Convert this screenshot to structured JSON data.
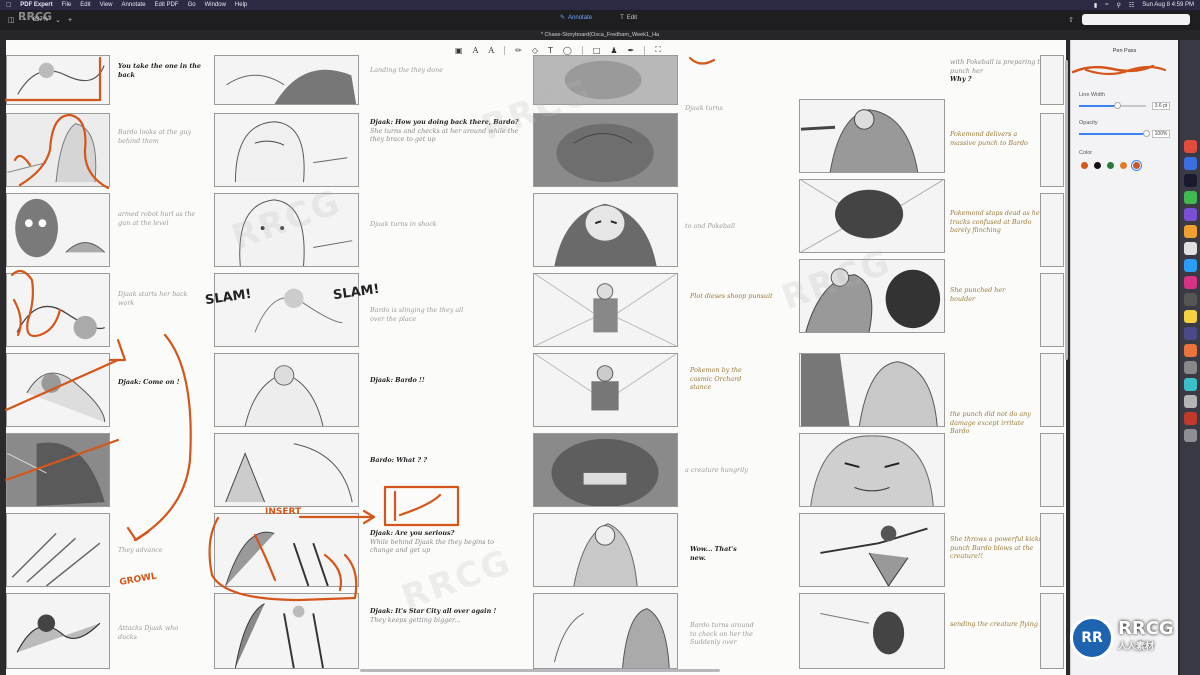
{
  "menubar": {
    "app_name": "PDF Expert",
    "menus": [
      "File",
      "Edit",
      "View",
      "Annotate",
      "Edit PDF",
      "Go",
      "Window",
      "Help"
    ],
    "clock": "Sun Aug 8  4:59 PM"
  },
  "toolbar": {
    "zoom": "837%",
    "modes": [
      {
        "label": "Annotate",
        "active": true
      },
      {
        "label": "Edit",
        "active": false
      }
    ],
    "search_placeholder": ""
  },
  "document": {
    "tab_title": "* Chase-Storyboard(Osca_Fredham_Week1_Ha"
  },
  "watermark": {
    "logo": "RRCG",
    "badge_circle": "RR",
    "badge_title": "RRCG",
    "badge_sub": "人人素材"
  },
  "panel": {
    "title": "Pen Pass",
    "line_width_label": "Line Width",
    "line_width_value": "3.6 pt",
    "line_width_fraction": 0.58,
    "opacity_label": "Opacity",
    "opacity_value": "100%",
    "opacity_fraction": 1.0,
    "color_label": "Color",
    "swatches": [
      "#d4561a",
      "#111111",
      "#2a7a3a",
      "#e07b26",
      "#c9562a"
    ],
    "selected_swatch": 4,
    "pen_color": "#d4561a"
  },
  "sketch_labels": {
    "slam_left": "SLAM!",
    "slam_right": "SLAM!",
    "insert": "INSERT",
    "growl": "GROWL"
  },
  "storyboard": {
    "column1_captions": [
      {
        "text": "You take the one in the back",
        "style": "bold"
      },
      {
        "text": "Bardo looks at the guy behind them",
        "style": "light"
      },
      {
        "text": "armed robot hurl as the gun at the level",
        "style": "light"
      },
      {
        "text": "Djaak starts her back work",
        "style": "light"
      },
      {
        "text": "Djaak: Come on !",
        "style": "bold"
      },
      {
        "text": "",
        "style": "light"
      },
      {
        "text": "They advance",
        "style": "light"
      },
      {
        "text": "Attacks Djaak who ducks",
        "style": "light"
      }
    ],
    "column2_captions": [
      {
        "text": "Landing the they done",
        "style": "light"
      },
      {
        "dialog": "Djaak: How you doing back there, Bardo?",
        "text": "She turns and checks at her around while the they brace to get up",
        "style": "mix"
      },
      {
        "text": "Djaak turns in shock",
        "style": "light"
      },
      {
        "text": "Bardo is slinging the they all over the place",
        "style": "light"
      },
      {
        "text": "Djaak: Bardo !!",
        "style": "bold"
      },
      {
        "text": "Bardo: What ? ?",
        "style": "bold"
      },
      {
        "dialog": "Djaak: Are you serious?",
        "text": "While behind Djaak the they begins to change and get up",
        "style": "mix"
      },
      {
        "dialog": "Djaak: It's Star City all over again !",
        "text": "They keeps getting bigger...",
        "style": "mix"
      }
    ],
    "column3_captions": [
      {
        "text": "",
        "style": "light"
      },
      {
        "text": "Djaak turns",
        "style": "light"
      },
      {
        "text": "to and Pokeball",
        "style": "light"
      },
      {
        "text": "Plot dieses shoop punsuit",
        "style": "gold"
      },
      {
        "text": "Pokemon by the cosmic Orchard stance",
        "style": "gold"
      },
      {
        "text": "a creature hungrily",
        "style": "light"
      },
      {
        "text": "Wow... That's new.",
        "style": "bold"
      },
      {
        "text": "Bardo turns around to check on her the Suddenly over",
        "style": "light"
      }
    ],
    "column4_captions": [
      {
        "dialog": "Why ?",
        "text": "with Pokeball is preparing to punch her",
        "style": "mix"
      },
      {
        "text": "Pokemond delivers a massive punch to Bardo",
        "style": "gold"
      },
      {
        "text": "Pokemond stops dead as he tracks confused at Bardo barely flinching",
        "style": "gold"
      },
      {
        "text": "She punched her boulder",
        "style": "gold"
      },
      {
        "text": "the punch did not do any damage except irritate Bardo",
        "style": "gold"
      },
      {
        "text": "",
        "style": "light"
      },
      {
        "text": "She throws a powerful kicks punch Bardo blows at the creature!!",
        "style": "gold"
      },
      {
        "text": "sending the creature flying",
        "style": "gold"
      }
    ]
  }
}
